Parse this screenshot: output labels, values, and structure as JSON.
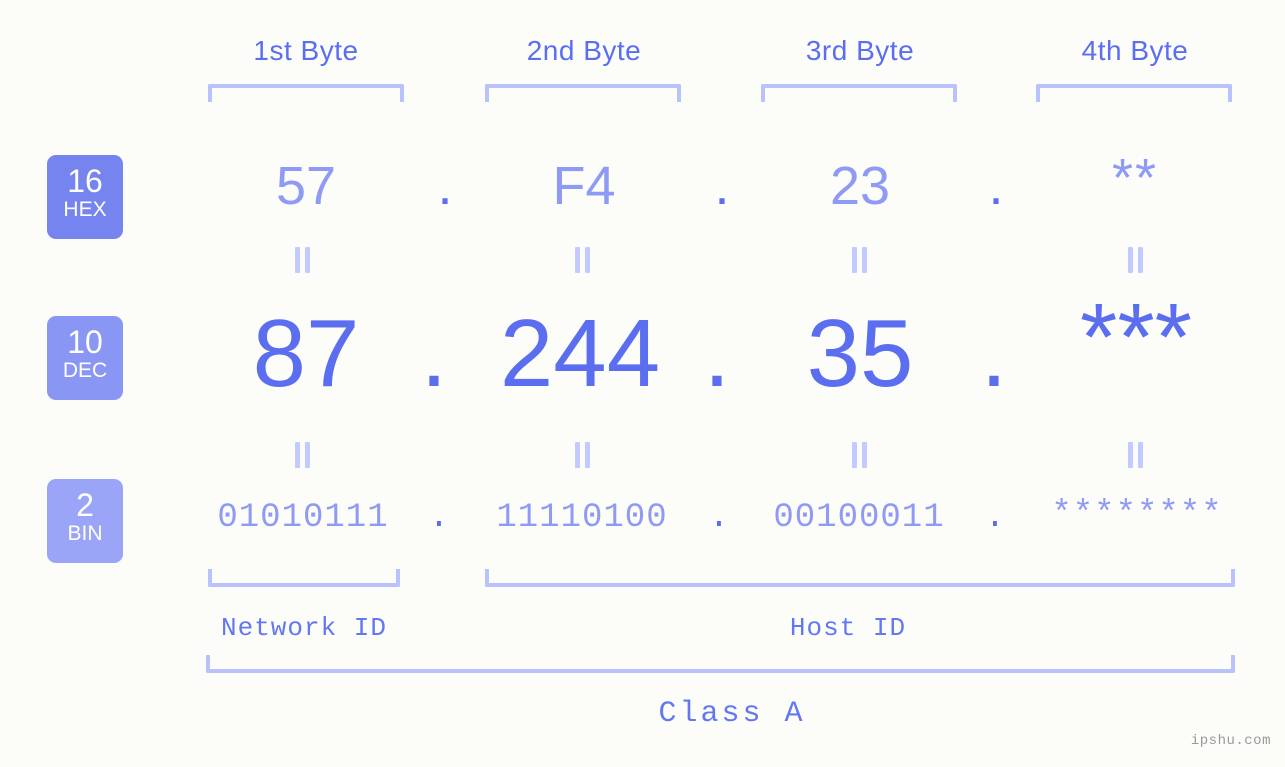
{
  "background_color": "#fcfdf8",
  "accent_color": "#5b6ef0",
  "accent_light": "#8e9af5",
  "bracket_color": "#b9c2fb",
  "headers": [
    {
      "label": "1st Byte"
    },
    {
      "label": "2nd Byte"
    },
    {
      "label": "3rd Byte"
    },
    {
      "label": "4th Byte"
    }
  ],
  "rows": [
    {
      "badge_number": "16",
      "badge_name": "HEX",
      "badge_color": "#7684ef",
      "values": [
        "57",
        "F4",
        "23",
        "**"
      ],
      "separators": [
        ".",
        ".",
        "."
      ]
    },
    {
      "badge_number": "10",
      "badge_name": "DEC",
      "badge_color": "#8a96f3",
      "values": [
        "87",
        "244",
        "35",
        "***"
      ],
      "separators": [
        ".",
        ".",
        "."
      ]
    },
    {
      "badge_number": "2",
      "badge_name": "BIN",
      "badge_color": "#9aa5f8",
      "values": [
        "01010111",
        "11110100",
        "00100011",
        "********"
      ],
      "separators": [
        ".",
        ".",
        "."
      ]
    }
  ],
  "id_labels": {
    "network": "Network ID",
    "host": "Host ID"
  },
  "class_label": "Class A",
  "watermark": "ipshu.com"
}
